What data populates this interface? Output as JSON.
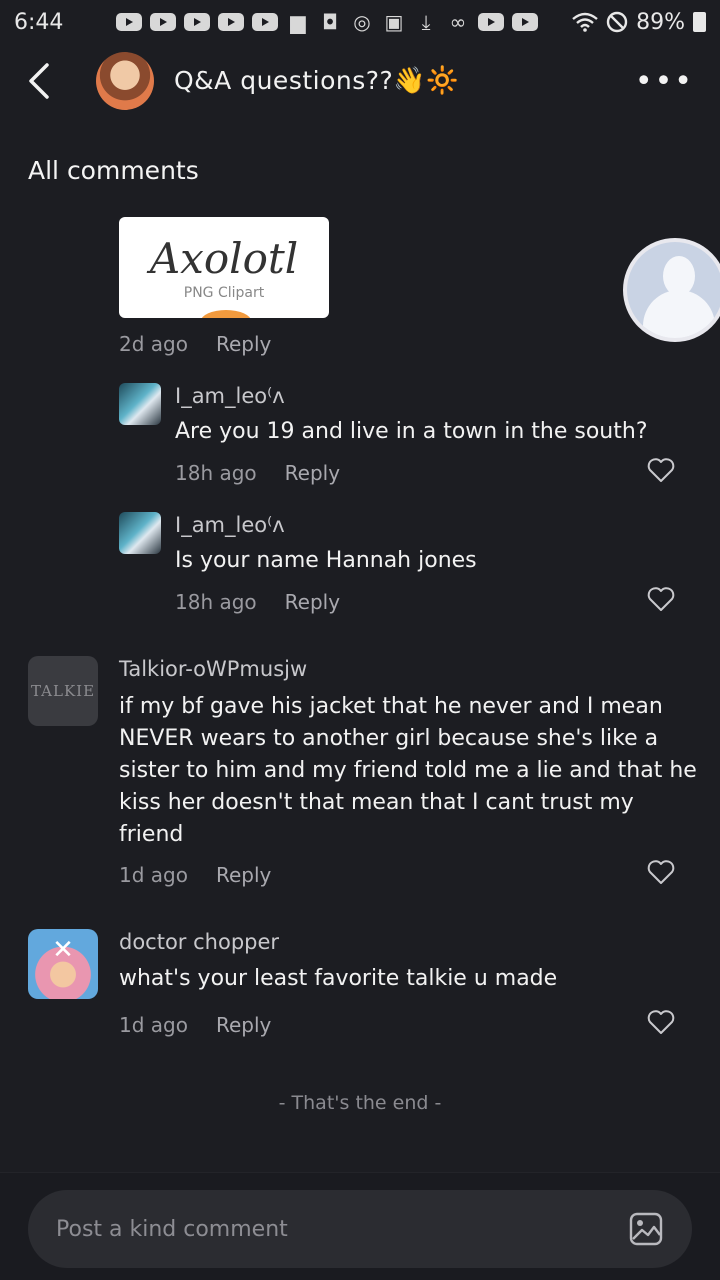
{
  "status_bar": {
    "time": "6:44",
    "battery": "89%",
    "icons": [
      "notification-icon",
      "folder-icon",
      "messenger-icon",
      "gallery-icon",
      "download-icon",
      "voicemail-icon",
      "wifi-icon",
      "do-not-disturb-icon",
      "battery-icon"
    ]
  },
  "header": {
    "title": "Q&A questions??",
    "title_emoji": "👋🔆",
    "more": "•••"
  },
  "section_title": "All comments",
  "image_comment": {
    "image_title": "Axolotl",
    "image_subtitle": "PNG Clipart",
    "time": "2d ago",
    "reply": "Reply"
  },
  "replies": [
    {
      "author": "I_am_leo⁽ᴧ",
      "text": "Are you 19 and live in a town in the south?",
      "time": "18h ago",
      "reply": "Reply"
    },
    {
      "author": "I_am_leo⁽ᴧ",
      "text": "Is your name Hannah jones",
      "time": "18h ago",
      "reply": "Reply"
    }
  ],
  "comments": [
    {
      "author": "Talkior-oWPmusjw",
      "avatar_text": "TALKIE",
      "lines": [
        "if my bf gave his jacket that he never and I mean",
        "NEVER wears to another girl because she's like a",
        "sister to him and my friend told me a lie and that he",
        "kiss her doesn't that mean that I cant trust my",
        "friend"
      ],
      "time": "1d ago",
      "reply": "Reply"
    },
    {
      "author": "doctor chopper",
      "avatar_text": "✕",
      "lines": [
        "what's your least favorite talkie u made"
      ],
      "time": "1d ago",
      "reply": "Reply"
    }
  ],
  "end_text": "- That's the end -",
  "composer": {
    "placeholder": "Post a kind comment"
  }
}
